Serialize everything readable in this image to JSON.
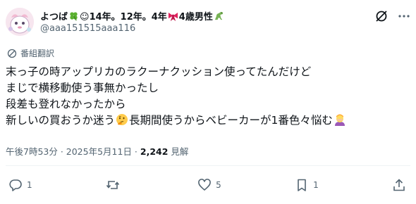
{
  "user": {
    "name_part1": "よつば",
    "name_part2": "☺14年。12年。4年",
    "name_part3": "4歳男性",
    "handle": "@aaa151515aaa116"
  },
  "translate_label": "番組翻訳",
  "body": {
    "line1": "末っ子の時アップリカのラクーナクッション使ってたんだけど",
    "line2": "まじで横移動使う事無かったし",
    "line3": "段差も登れなかったから",
    "line4_a": "新しいの買おうか迷う",
    "line4_b": "長期間使うからベビーカーが1番色々悩む"
  },
  "meta": {
    "time": "午後7時53分",
    "date": "2025年5月11日",
    "views_count": "2,242",
    "views_label": "見解"
  },
  "actions": {
    "reply_count": "1",
    "repost_count": "",
    "like_count": "5",
    "bookmark_count": "1"
  },
  "icons": {
    "name_emoji1": "four-leaf-clover",
    "name_emoji2": "ribbon",
    "name_emoji3": "dinosaur",
    "body_emoji1": "thinking-face",
    "body_emoji2": "person-facepalming"
  }
}
